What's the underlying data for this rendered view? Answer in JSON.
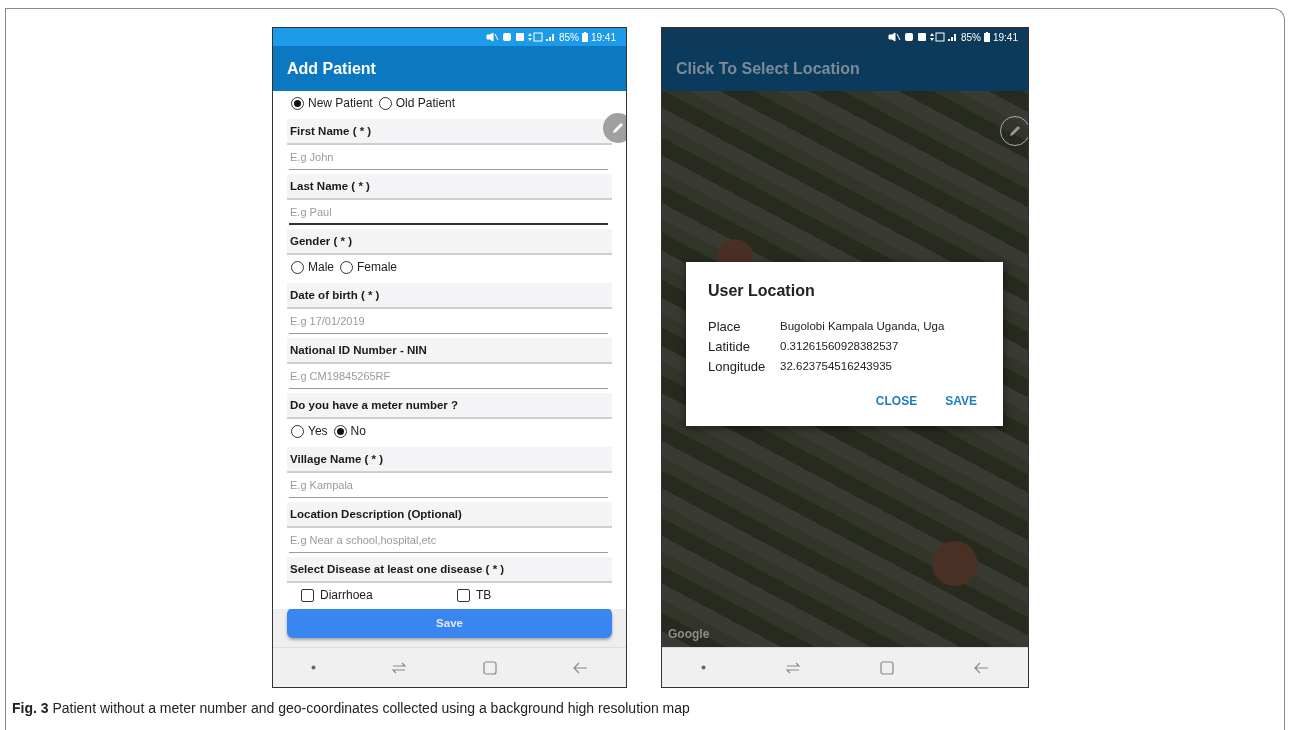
{
  "phones": [
    {
      "kind": "form",
      "status_bar": {
        "battery": "85%",
        "time": "19:41"
      },
      "app_bar": {
        "title": "Add Patient",
        "dimmed": false
      },
      "items": [
        {
          "kind": "radios",
          "options": [
            {
              "label": "New Patient",
              "selected": true
            },
            {
              "label": "Old Patient",
              "selected": false
            }
          ]
        },
        {
          "kind": "field",
          "label": "First Name ( * )",
          "placeholder": "E.g John",
          "focused": false
        },
        {
          "kind": "field",
          "label": "Last Name ( * )",
          "placeholder": "E.g Paul",
          "focused": true
        },
        {
          "kind": "heading",
          "label": "Gender ( * )"
        },
        {
          "kind": "radios",
          "options": [
            {
              "label": "Male",
              "selected": false
            },
            {
              "label": "Female",
              "selected": false
            }
          ]
        },
        {
          "kind": "field",
          "label": "Date of birth ( * )",
          "placeholder": "E.g 17/01/2019",
          "focused": false
        },
        {
          "kind": "field",
          "label": "National ID Number - NIN",
          "placeholder": "E.g CM19845265RF",
          "focused": false
        },
        {
          "kind": "heading",
          "label": "Do you have a meter number ?"
        },
        {
          "kind": "radios",
          "options": [
            {
              "label": "Yes",
              "selected": false
            },
            {
              "label": "No",
              "selected": true
            }
          ]
        },
        {
          "kind": "field",
          "label": "Village Name ( * )",
          "placeholder": "E.g Kampala",
          "focused": false
        },
        {
          "kind": "field",
          "label": "Location Description (Optional)",
          "placeholder": "E.g Near a school,hospital,etc",
          "focused": false
        },
        {
          "kind": "heading",
          "label": "Select Disease at least one disease ( * )"
        },
        {
          "kind": "checkboxes",
          "options": [
            {
              "label": "Diarrhoea",
              "checked": false
            },
            {
              "label": "TB",
              "checked": false
            }
          ]
        }
      ],
      "save_button": "Save"
    },
    {
      "kind": "map",
      "status_bar": {
        "battery": "85%",
        "time": "19:41"
      },
      "app_bar": {
        "title": "Click To Select Location",
        "dimmed": true
      },
      "map_attribution": "Google",
      "dialog": {
        "title": "User Location",
        "rows": [
          {
            "label": "Place",
            "value": "Bugolobi Kampala Uganda, Uga"
          },
          {
            "label": "Latitide",
            "value": "0.31261560928382537"
          },
          {
            "label": "Longitude",
            "value": "32.623754516243935"
          }
        ],
        "buttons": [
          "CLOSE",
          "SAVE"
        ]
      }
    }
  ],
  "caption": "**Fig. 3** Patient without a meter number and geo-coordinates collected using a background high resolution map"
}
